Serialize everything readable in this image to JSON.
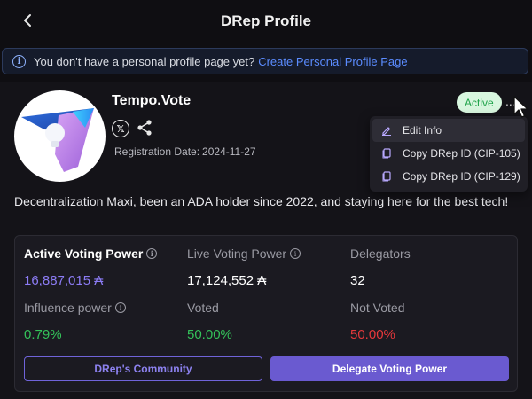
{
  "header": {
    "title": "DRep Profile",
    "back_icon": "chevron-left-icon"
  },
  "notice": {
    "icon": "info-icon",
    "text": "You don't have a personal profile page yet?",
    "link": "Create Personal Profile Page"
  },
  "profile": {
    "name": "Tempo.Vote",
    "social_icons": [
      "x-logo-icon",
      "share-icon"
    ],
    "registration_label": "Registration Date:",
    "registration_date": "2024-11-27",
    "status": "Active",
    "more_label": "...",
    "bio": "Decentralization Maxi, been an ADA holder since 2022, and staying here for the best tech!"
  },
  "menu": {
    "items": [
      {
        "label": "Edit Info",
        "icon": "edit-icon"
      },
      {
        "label": "Copy DRep ID (CIP-105)",
        "icon": "copy-icon"
      },
      {
        "label": "Copy DRep ID (CIP-129)",
        "icon": "copy-icon"
      }
    ]
  },
  "stats": {
    "active_power_label": "Active Voting Power",
    "active_power_value": "16,887,015 ₳",
    "live_power_label": "Live Voting Power",
    "live_power_value": "17,124,552 ₳",
    "delegators_label": "Delegators",
    "delegators_value": "32",
    "influence_label": "Influence power",
    "influence_value": "0.79%",
    "voted_label": "Voted",
    "voted_value": "50.00%",
    "not_voted_label": "Not Voted",
    "not_voted_value": "50.00%"
  },
  "actions": {
    "community_label": "DRep's Community",
    "delegate_label": "Delegate Voting Power"
  },
  "colors": {
    "accent": "#6a5ad0",
    "link": "#5b8cff",
    "positive": "#34c25a",
    "negative": "#e5383b",
    "active_badge": "#d8f7df"
  }
}
